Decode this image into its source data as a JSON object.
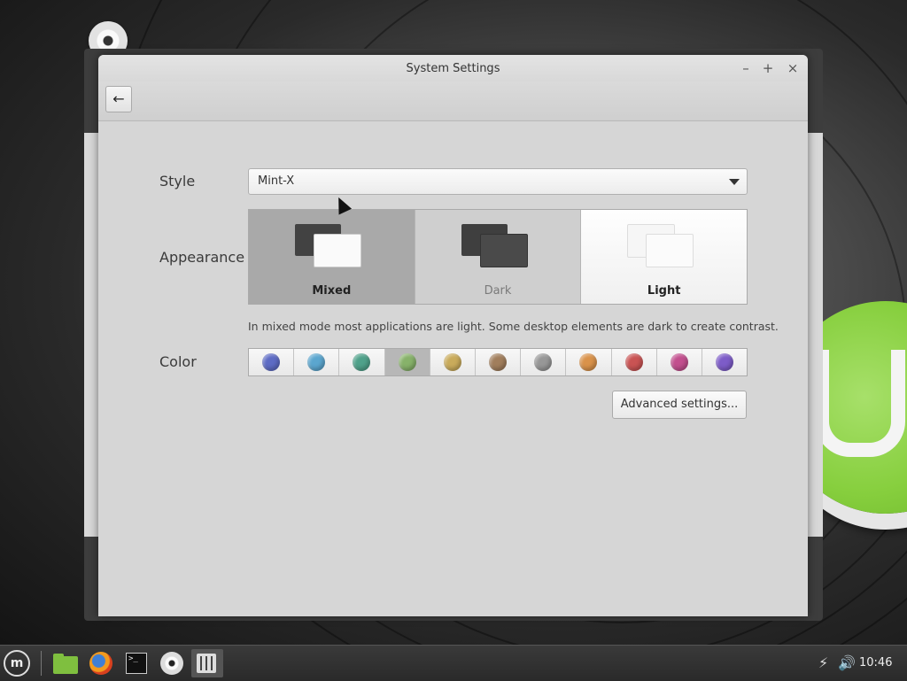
{
  "window": {
    "title": "System Settings"
  },
  "titlebar": {
    "minimize": "–",
    "maximize": "+",
    "close": "×"
  },
  "toolbar": {
    "back_icon": "←"
  },
  "style": {
    "label": "Style",
    "value": "Mint-X"
  },
  "appearance": {
    "label": "Appearance",
    "options": [
      {
        "label": "Mixed",
        "selected": true
      },
      {
        "label": "Dark",
        "selected": false
      },
      {
        "label": "Light",
        "selected": false
      }
    ],
    "description": "In mixed mode most applications are light. Some desktop elements are dark to create contrast."
  },
  "color": {
    "label": "Color",
    "selected_index": 3,
    "swatches": [
      "#5d6bc4",
      "#5ba6cf",
      "#4fa18a",
      "#87b26a",
      "#c9ab5b",
      "#a17e5c",
      "#979797",
      "#d9924a",
      "#c95353",
      "#c24f8e",
      "#7d5cc8"
    ]
  },
  "advanced": {
    "label": "Advanced settings..."
  },
  "taskbar": {
    "menu_icon": "m",
    "terminal_text": ">_",
    "volume_icon": "🔊",
    "network_icon": "⚡",
    "clock": "10:46"
  }
}
